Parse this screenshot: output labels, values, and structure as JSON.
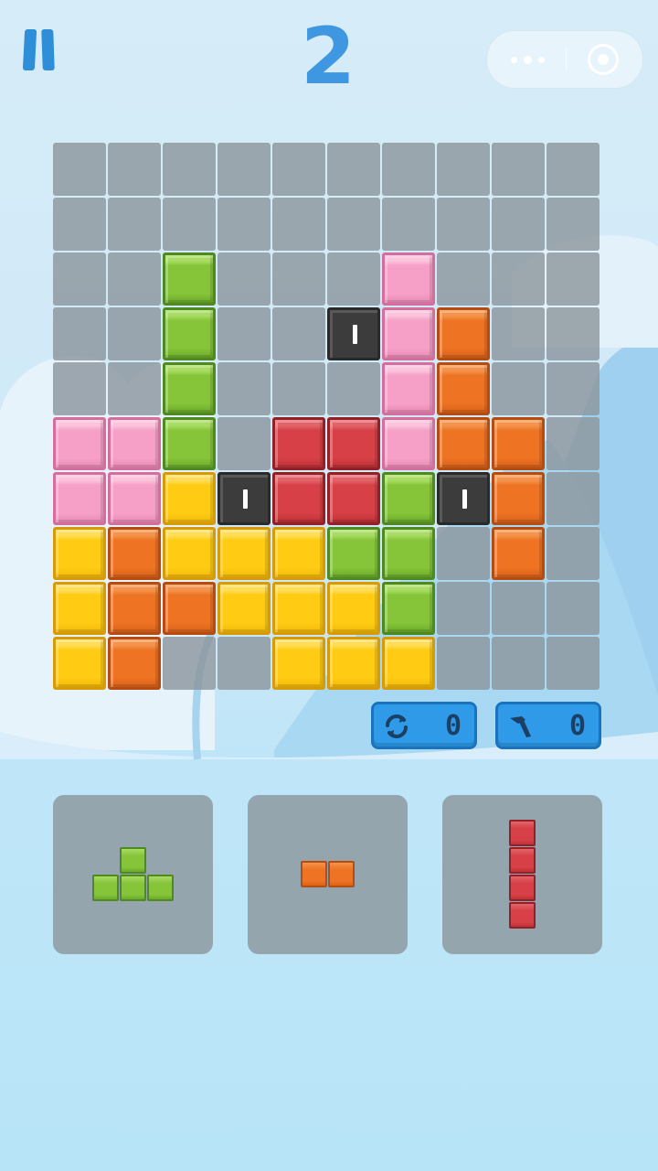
{
  "header": {
    "score": "2",
    "pause_icon": "pause-icon",
    "menu_icon": "more-dots-icon",
    "close_icon": "target-circle-icon"
  },
  "colors": {
    "green": {
      "base": "#86c53a",
      "light": "#a8dc63",
      "shade": "#6aa92a",
      "dark": "#4e8a1f"
    },
    "pink": {
      "base": "#f6a0c7",
      "light": "#fbc3dc",
      "shade": "#e88bb4",
      "dark": "#d56d9d"
    },
    "orange": {
      "base": "#ee7424",
      "light": "#f4934c",
      "shade": "#d9621a",
      "dark": "#b54d12"
    },
    "red": {
      "base": "#d64046",
      "light": "#e2646a",
      "shade": "#bd3137",
      "dark": "#922127"
    },
    "yellow": {
      "base": "#ffcc13",
      "light": "#ffdd5a",
      "shade": "#f2b90c",
      "dark": "#d99a07"
    },
    "stone": {
      "base": "#3c3c3c",
      "light": "#555555",
      "shade": "#333333",
      "dark": "#2a2a2a"
    }
  },
  "board": {
    "cols": 10,
    "rows": 10,
    "grid": [
      [
        ".",
        ".",
        ".",
        ".",
        ".",
        ".",
        ".",
        ".",
        ".",
        "."
      ],
      [
        ".",
        ".",
        ".",
        ".",
        ".",
        ".",
        ".",
        ".",
        ".",
        "."
      ],
      [
        ".",
        ".",
        "G",
        ".",
        ".",
        ".",
        "P",
        ".",
        ".",
        "."
      ],
      [
        ".",
        ".",
        "G",
        ".",
        ".",
        "S",
        "P",
        "O",
        ".",
        "."
      ],
      [
        ".",
        ".",
        "G",
        ".",
        ".",
        ".",
        "P",
        "O",
        ".",
        "."
      ],
      [
        "P",
        "P",
        "G",
        ".",
        "R",
        "R",
        "P",
        "O",
        "O",
        "."
      ],
      [
        "P",
        "P",
        "Y",
        "S",
        "R",
        "R",
        "G",
        "S",
        "O",
        "."
      ],
      [
        "Y",
        "O",
        "Y",
        "Y",
        "Y",
        "G",
        "G",
        ".",
        "O",
        "."
      ],
      [
        "Y",
        "O",
        "O",
        "Y",
        "Y",
        "Y",
        "G",
        ".",
        ".",
        "."
      ],
      [
        "Y",
        "O",
        ".",
        ".",
        "Y",
        "Y",
        "Y",
        ".",
        ".",
        "."
      ]
    ],
    "legend": {
      "G": "green",
      "P": "pink",
      "O": "orange",
      "R": "red",
      "Y": "yellow",
      "S": "stone"
    }
  },
  "tools": [
    {
      "name": "refresh",
      "icon": "refresh-icon",
      "count": "0"
    },
    {
      "name": "hammer",
      "icon": "hammer-icon",
      "count": "0"
    }
  ],
  "pieces": [
    {
      "color": "green",
      "shape": [
        [
          1,
          0
        ],
        [
          0,
          1
        ],
        [
          1,
          1
        ],
        [
          2,
          1
        ]
      ]
    },
    {
      "color": "orange",
      "shape": [
        [
          0,
          0
        ],
        [
          1,
          0
        ]
      ]
    },
    {
      "color": "red",
      "shape": [
        [
          0,
          0
        ],
        [
          0,
          1
        ],
        [
          0,
          2
        ],
        [
          0,
          3
        ]
      ]
    }
  ]
}
